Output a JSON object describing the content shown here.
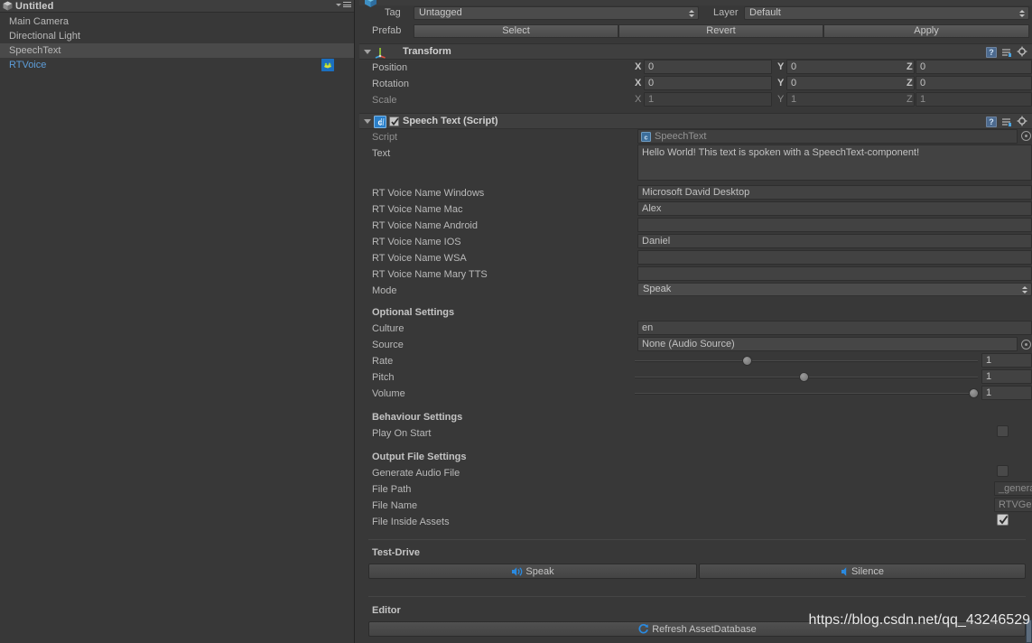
{
  "hierarchy": {
    "title": "Untitled",
    "scene_icon": "unity-scene-icon",
    "menu_icon": "hamburger-menu-icon",
    "dropdown_icon": "chevron-down-icon",
    "items": [
      {
        "label": "Main Camera",
        "selected": false,
        "prefab": false,
        "icon": null
      },
      {
        "label": "Directional Light",
        "selected": false,
        "prefab": false,
        "icon": null
      },
      {
        "label": "SpeechText",
        "selected": true,
        "prefab": false,
        "icon": null
      },
      {
        "label": "RTVoice",
        "selected": false,
        "prefab": true,
        "icon": "rtvoice-prefab-icon"
      }
    ]
  },
  "inspector": {
    "object_icon": "game-object-icon",
    "tag": {
      "label": "Tag",
      "value": "Untagged"
    },
    "layer": {
      "label": "Layer",
      "value": "Default"
    },
    "prefab": {
      "label": "Prefab",
      "buttons": [
        "Select",
        "Revert",
        "Apply"
      ]
    },
    "transform": {
      "title": "Transform",
      "icon": "transform-axis-icon",
      "help_icon": "help-icon",
      "preset_icon": "preset-icon",
      "gear_icon": "gear-icon",
      "rows": [
        {
          "label": "Position",
          "dim": false,
          "x": "0",
          "y": "0",
          "z": "0"
        },
        {
          "label": "Rotation",
          "dim": false,
          "x": "0",
          "y": "0",
          "z": "0"
        },
        {
          "label": "Scale",
          "dim": true,
          "x": "1",
          "y": "1",
          "z": "1"
        }
      ],
      "axes": [
        "X",
        "Y",
        "Z"
      ]
    },
    "speech_text": {
      "title": "Speech Text (Script)",
      "enabled": true,
      "icon": "cs-script-icon",
      "help_icon": "help-icon",
      "preset_icon": "preset-icon",
      "gear_icon": "gear-icon",
      "script": {
        "label": "Script",
        "value": "SpeechText",
        "chip_icon": "cs-script-icon",
        "picker_icon": "object-picker-icon"
      },
      "text": {
        "label": "Text",
        "value": "Hello World! This text is spoken with a SpeechText-component!"
      },
      "voice_names": [
        {
          "label": "RT Voice Name Windows",
          "value": "Microsoft David Desktop"
        },
        {
          "label": "RT Voice Name Mac",
          "value": "Alex"
        },
        {
          "label": "RT Voice Name Android",
          "value": ""
        },
        {
          "label": "RT Voice Name IOS",
          "value": "Daniel"
        },
        {
          "label": "RT Voice Name WSA",
          "value": ""
        },
        {
          "label": "RT Voice Name Mary TTS",
          "value": ""
        }
      ],
      "mode": {
        "label": "Mode",
        "value": "Speak"
      },
      "optional_settings": {
        "header": "Optional Settings",
        "culture": {
          "label": "Culture",
          "value": "en"
        },
        "source": {
          "label": "Source",
          "value": "None (Audio Source)",
          "picker_icon": "object-picker-icon"
        },
        "sliders": [
          {
            "label": "Rate",
            "value": "1",
            "percent": 34
          },
          {
            "label": "Pitch",
            "value": "1",
            "percent": 52
          },
          {
            "label": "Volume",
            "value": "1",
            "percent": 100
          }
        ]
      },
      "behaviour_settings": {
        "header": "Behaviour Settings",
        "play_on_start": {
          "label": "Play On Start",
          "checked": false
        }
      },
      "output_file_settings": {
        "header": "Output File Settings",
        "generate_audio_file": {
          "label": "Generate Audio File",
          "checked": false
        },
        "file_path": {
          "label": "File Path",
          "value": "_generatedAudio/"
        },
        "file_name": {
          "label": "File Name",
          "value": "RTVGeneratedAudio"
        },
        "file_inside_assets": {
          "label": "File Inside Assets",
          "checked": true
        }
      },
      "test_drive": {
        "header": "Test-Drive",
        "speak_button": {
          "label": "Speak",
          "icon": "speaker-on-icon"
        },
        "silence_button": {
          "label": "Silence",
          "icon": "speaker-mute-icon"
        }
      },
      "editor": {
        "header": "Editor",
        "refresh_button": {
          "label": "Refresh AssetDatabase",
          "icon": "refresh-icon"
        }
      }
    }
  },
  "watermark": {
    "text": "https://blog.csdn.net/qq_43246529"
  },
  "colors": {
    "panel_bg": "#383838",
    "header_bg": "#3f3f3f",
    "selection": "#4a4a4a",
    "prefab_blue": "#5d9dd8",
    "accent_blue": "#2a8ae0",
    "field_bg": "#424242",
    "text": "#b9b9b9"
  }
}
